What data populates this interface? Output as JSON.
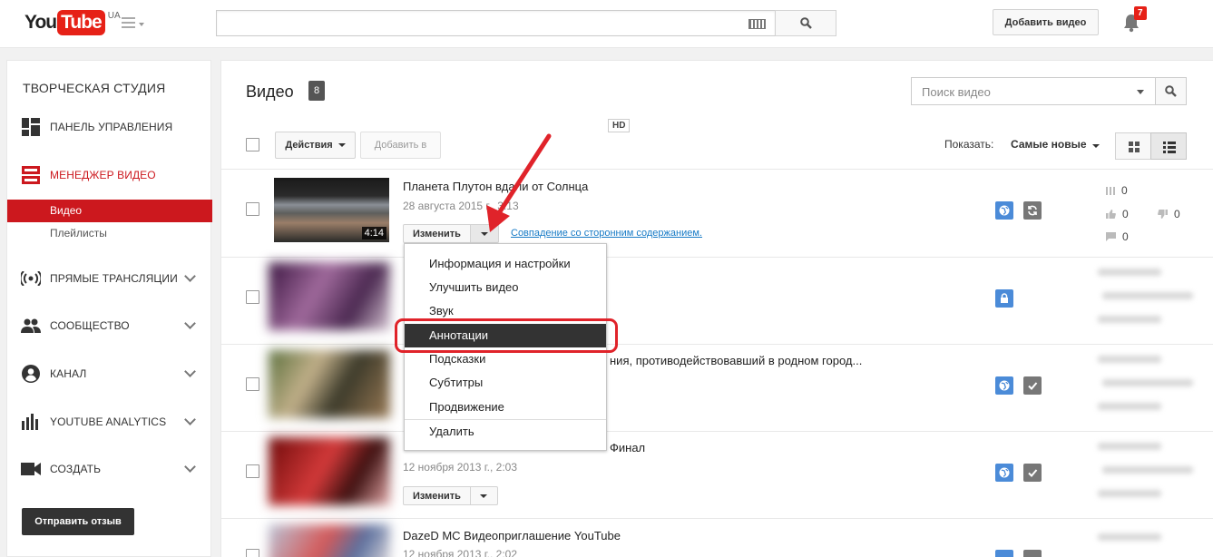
{
  "header": {
    "logo_you": "You",
    "logo_tube": "Tube",
    "logo_region": "UA",
    "upload_label": "Добавить видео",
    "notification_count": "7"
  },
  "sidebar": {
    "title": "ТВОРЧЕСКАЯ СТУДИЯ",
    "items": [
      {
        "label": "ПАНЕЛЬ УПРАВЛЕНИЯ",
        "icon": "dashboard-icon"
      },
      {
        "label": "МЕНЕДЖЕР ВИДЕО",
        "icon": "video-manager-icon",
        "active": true
      },
      {
        "label": "ПРЯМЫЕ ТРАНСЛЯЦИИ",
        "icon": "live-icon"
      },
      {
        "label": "СООБЩЕСТВО",
        "icon": "community-icon"
      },
      {
        "label": "КАНАЛ",
        "icon": "channel-icon"
      },
      {
        "label": "YOUTUBE ANALYTICS",
        "icon": "analytics-icon"
      },
      {
        "label": "СОЗДАТЬ",
        "icon": "create-icon"
      }
    ],
    "sub_items": [
      {
        "label": "Видео",
        "active": true
      },
      {
        "label": "Плейлисты"
      }
    ],
    "feedback_label": "Отправить отзыв"
  },
  "main": {
    "title": "Видео",
    "count": "8",
    "search_placeholder": "Поиск видео",
    "actions_label": "Действия",
    "add_to_label": "Добавить в",
    "show_label": "Показать:",
    "sort_value": "Самые новые"
  },
  "videos": [
    {
      "title": "Планета Плутон вдали от Солнца",
      "hd": "HD",
      "date": "28 августа 2015 г., 3:13",
      "duration": "4:14",
      "edit_label": "Изменить",
      "claim": "Совпадение со сторонним содержанием.",
      "views": "0",
      "likes": "0",
      "dislikes": "0",
      "comments": "0"
    },
    {
      "title": "",
      "date": ""
    },
    {
      "title_suffix": "ния, противодействовавший в родном город...",
      "date": ""
    },
    {
      "title_suffix": "Финал",
      "date": "12 ноября 2013 г., 2:03",
      "edit_label": "Изменить"
    },
    {
      "title": "DazeD MC Видеоприглашение YouTube",
      "date": "12 ноября 2013 г., 2:02"
    }
  ],
  "dropdown": {
    "items": [
      "Информация и настройки",
      "Улучшить видео",
      "Звук",
      "Аннотации",
      "Подсказки",
      "Субтитры",
      "Продвижение",
      "Удалить"
    ],
    "highlighted": "Аннотации"
  },
  "colors": {
    "brand_red": "#e62117",
    "active_red": "#cc181e",
    "annotation_red": "#e0232a",
    "public_blue": "#4b8bd8"
  }
}
